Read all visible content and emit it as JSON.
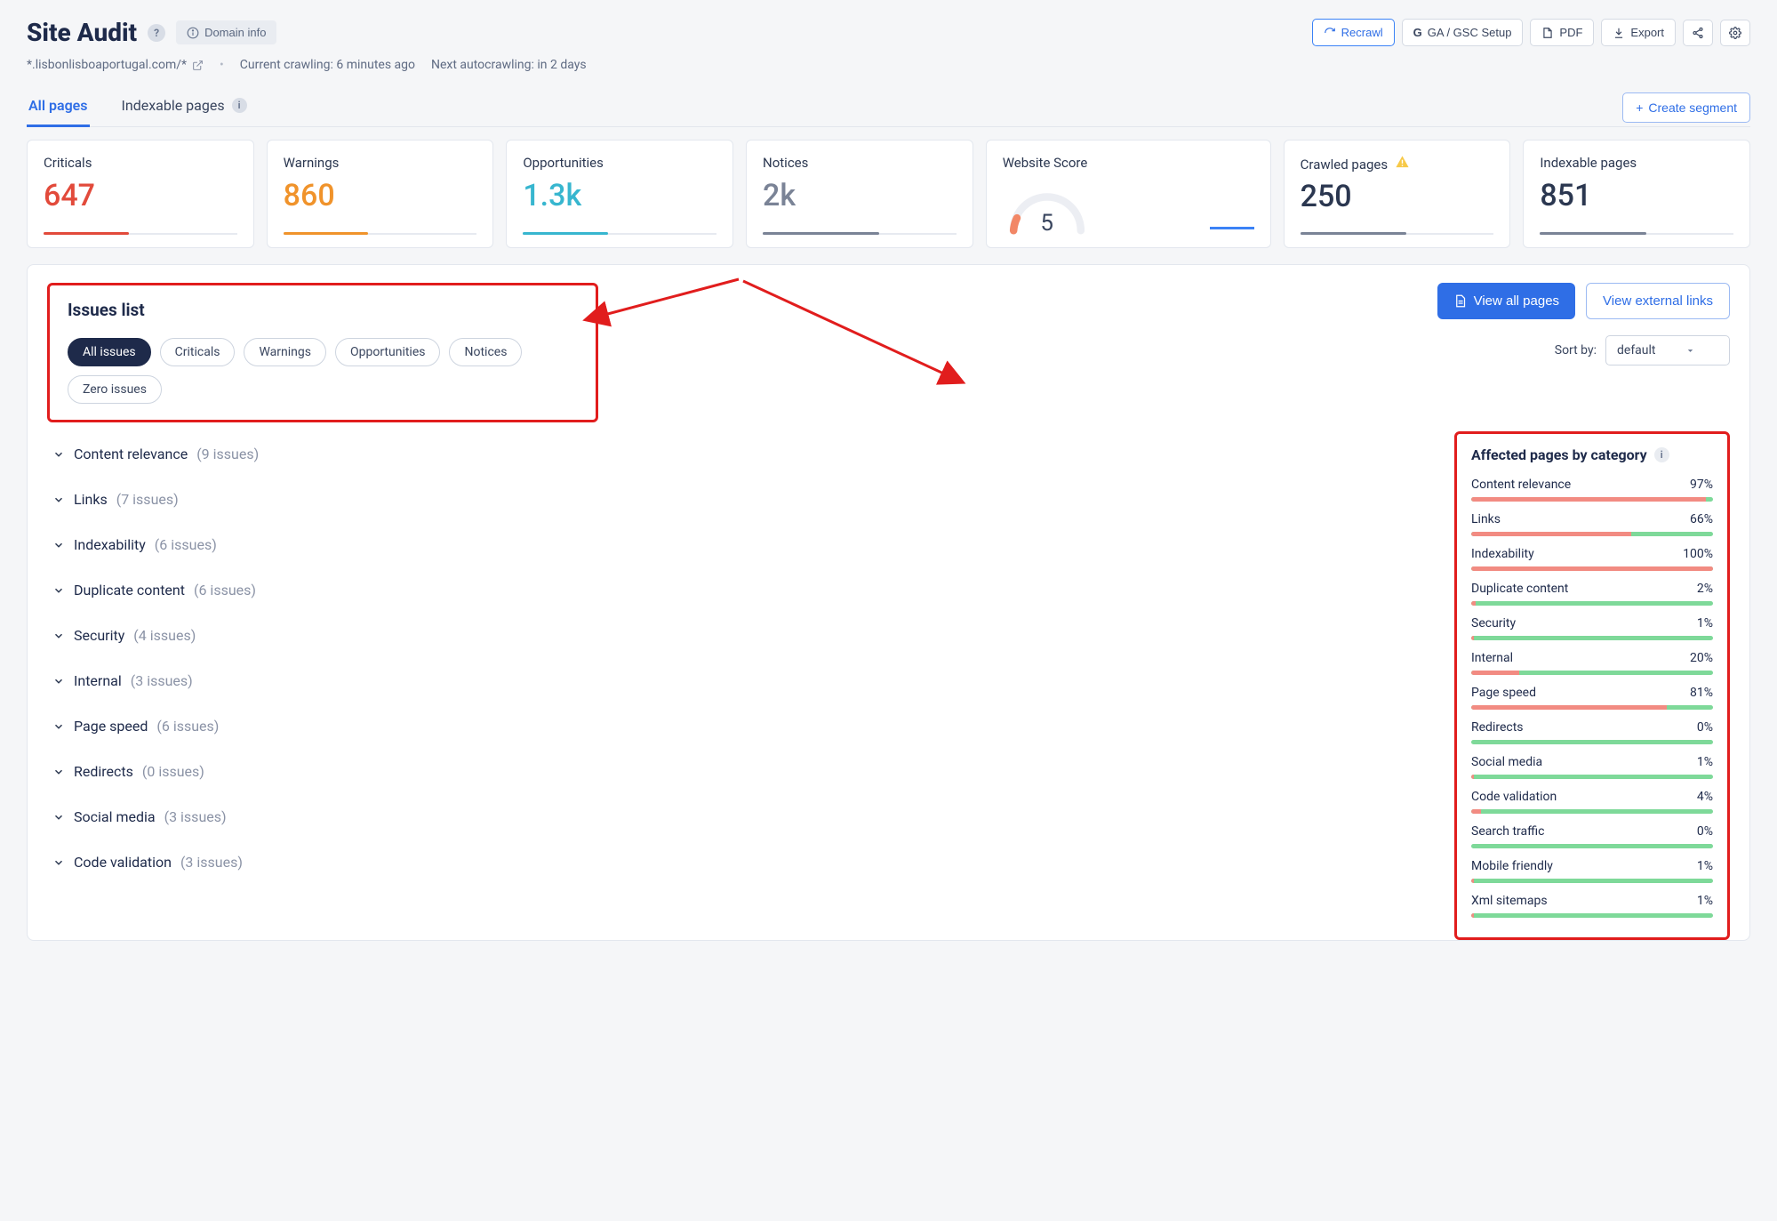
{
  "header": {
    "title": "Site Audit",
    "domain_info_label": "Domain info"
  },
  "toolbar": {
    "recrawl": "Recrawl",
    "ga_gsc": "GA / GSC Setup",
    "pdf": "PDF",
    "export": "Export"
  },
  "subheader": {
    "domain": "*.lisbonlisboaportugal.com/*",
    "crawling": "Current crawling: 6 minutes ago",
    "next": "Next autocrawling: in 2 days"
  },
  "tabs": {
    "all_pages": "All pages",
    "indexable_pages": "Indexable pages",
    "create_segment": "Create segment"
  },
  "stats": {
    "criticals": {
      "label": "Criticals",
      "value": "647"
    },
    "warnings": {
      "label": "Warnings",
      "value": "860"
    },
    "opportunities": {
      "label": "Opportunities",
      "value": "1.3k"
    },
    "notices": {
      "label": "Notices",
      "value": "2k"
    },
    "website_score": {
      "label": "Website Score",
      "value": "5"
    },
    "crawled": {
      "label": "Crawled pages",
      "value": "250"
    },
    "indexable": {
      "label": "Indexable pages",
      "value": "851"
    }
  },
  "issues_panel": {
    "title": "Issues list",
    "filters": {
      "all": "All issues",
      "criticals": "Criticals",
      "warnings": "Warnings",
      "opportunities": "Opportunities",
      "notices": "Notices",
      "zero": "Zero issues"
    },
    "view_all_pages": "View all pages",
    "view_external_links": "View external links",
    "sort_label": "Sort by:",
    "sort_value": "default"
  },
  "issues_list": [
    {
      "name": "Content relevance",
      "count": "(9 issues)"
    },
    {
      "name": "Links",
      "count": "(7 issues)"
    },
    {
      "name": "Indexability",
      "count": "(6 issues)"
    },
    {
      "name": "Duplicate content",
      "count": "(6 issues)"
    },
    {
      "name": "Security",
      "count": "(4 issues)"
    },
    {
      "name": "Internal",
      "count": "(3 issues)"
    },
    {
      "name": "Page speed",
      "count": "(6 issues)"
    },
    {
      "name": "Redirects",
      "count": "(0 issues)"
    },
    {
      "name": "Social media",
      "count": "(3 issues)"
    },
    {
      "name": "Code validation",
      "count": "(3 issues)"
    }
  ],
  "affected": {
    "title": "Affected pages by category",
    "items": [
      {
        "name": "Content relevance",
        "pct": "97%",
        "red": 97
      },
      {
        "name": "Links",
        "pct": "66%",
        "red": 66
      },
      {
        "name": "Indexability",
        "pct": "100%",
        "red": 100
      },
      {
        "name": "Duplicate content",
        "pct": "2%",
        "red": 2
      },
      {
        "name": "Security",
        "pct": "1%",
        "red": 1
      },
      {
        "name": "Internal",
        "pct": "20%",
        "red": 20
      },
      {
        "name": "Page speed",
        "pct": "81%",
        "red": 81
      },
      {
        "name": "Redirects",
        "pct": "0%",
        "red": 0
      },
      {
        "name": "Social media",
        "pct": "1%",
        "red": 1
      },
      {
        "name": "Code validation",
        "pct": "4%",
        "red": 4
      },
      {
        "name": "Search traffic",
        "pct": "0%",
        "red": 0
      },
      {
        "name": "Mobile friendly",
        "pct": "1%",
        "red": 1
      },
      {
        "name": "Xml sitemaps",
        "pct": "1%",
        "red": 1
      }
    ]
  }
}
